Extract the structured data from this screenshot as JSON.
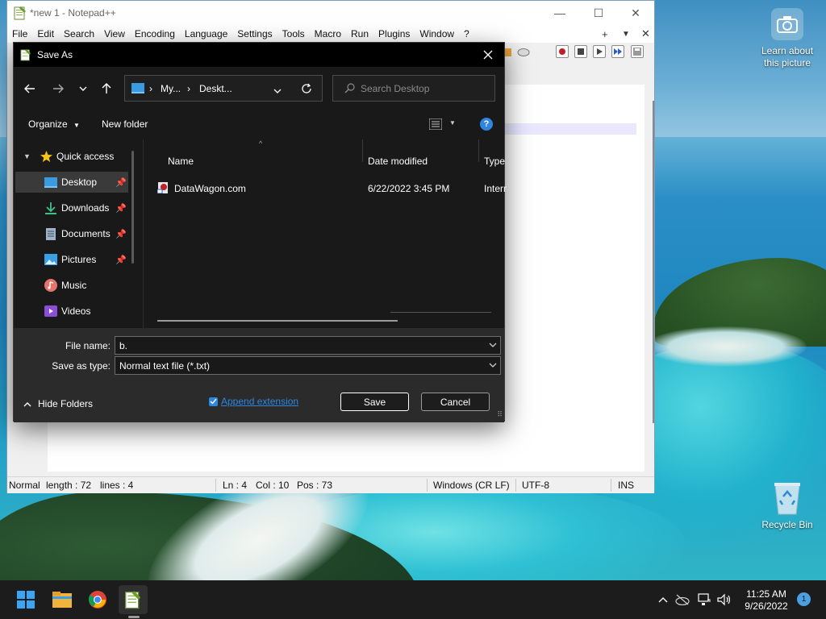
{
  "desktop": {
    "camera_label": "Learn about this picture",
    "recycle_label": "Recycle Bin"
  },
  "notepad": {
    "title": "*new 1 - Notepad++",
    "menu": [
      "File",
      "Edit",
      "Search",
      "View",
      "Encoding",
      "Language",
      "Settings",
      "Tools",
      "Macro",
      "Run",
      "Plugins",
      "Window",
      "?"
    ],
    "menu_right": {
      "add": "+",
      "dropdown": "▼",
      "close": "✕"
    },
    "status": {
      "mode": "Normal",
      "length": "length : 72",
      "lines": "lines : 4",
      "ln": "Ln : 4",
      "col": "Col : 10",
      "pos": "Pos : 73",
      "eol": "Windows (CR LF)",
      "encoding": "UTF-8",
      "ins": "INS"
    }
  },
  "dialog": {
    "title": "Save As",
    "breadcrumb": [
      "My...",
      "Deskt..."
    ],
    "search_placeholder": "Search Desktop",
    "organize_label": "Organize",
    "new_folder_label": "New folder",
    "nav": [
      {
        "label": "Quick access",
        "icon": "star-icon",
        "pinned": false
      },
      {
        "label": "Desktop",
        "icon": "desktop-icon",
        "pinned": true
      },
      {
        "label": "Downloads",
        "icon": "download-icon",
        "pinned": true
      },
      {
        "label": "Documents",
        "icon": "document-icon",
        "pinned": true
      },
      {
        "label": "Pictures",
        "icon": "pictures-icon",
        "pinned": true
      },
      {
        "label": "Music",
        "icon": "music-icon",
        "pinned": false
      },
      {
        "label": "Videos",
        "icon": "video-icon",
        "pinned": false
      }
    ],
    "columns": [
      "Name",
      "Date modified",
      "Type"
    ],
    "files": [
      {
        "name": "DataWagon.com",
        "date": "6/22/2022 3:45 PM",
        "type": "Intern"
      }
    ],
    "file_name_label": "File name:",
    "file_name_value": "b.",
    "save_type_label": "Save as type:",
    "save_type_value": "Normal text file (*.txt)",
    "hide_folders_label": "Hide Folders",
    "append_extension_label": "Append extension",
    "append_extension_checked": true,
    "save_label": "Save",
    "cancel_label": "Cancel"
  },
  "taskbar": {
    "time": "11:25 AM",
    "date": "9/26/2022",
    "notification_count": "1",
    "apps": [
      "windows-start-icon",
      "file-explorer-icon",
      "chrome-icon",
      "notepad-plus-plus-icon"
    ]
  },
  "colors": {
    "dialog_bg": "#202020",
    "accent": "#4ca0e0",
    "taskbar_bg": "#1c1c1c"
  }
}
